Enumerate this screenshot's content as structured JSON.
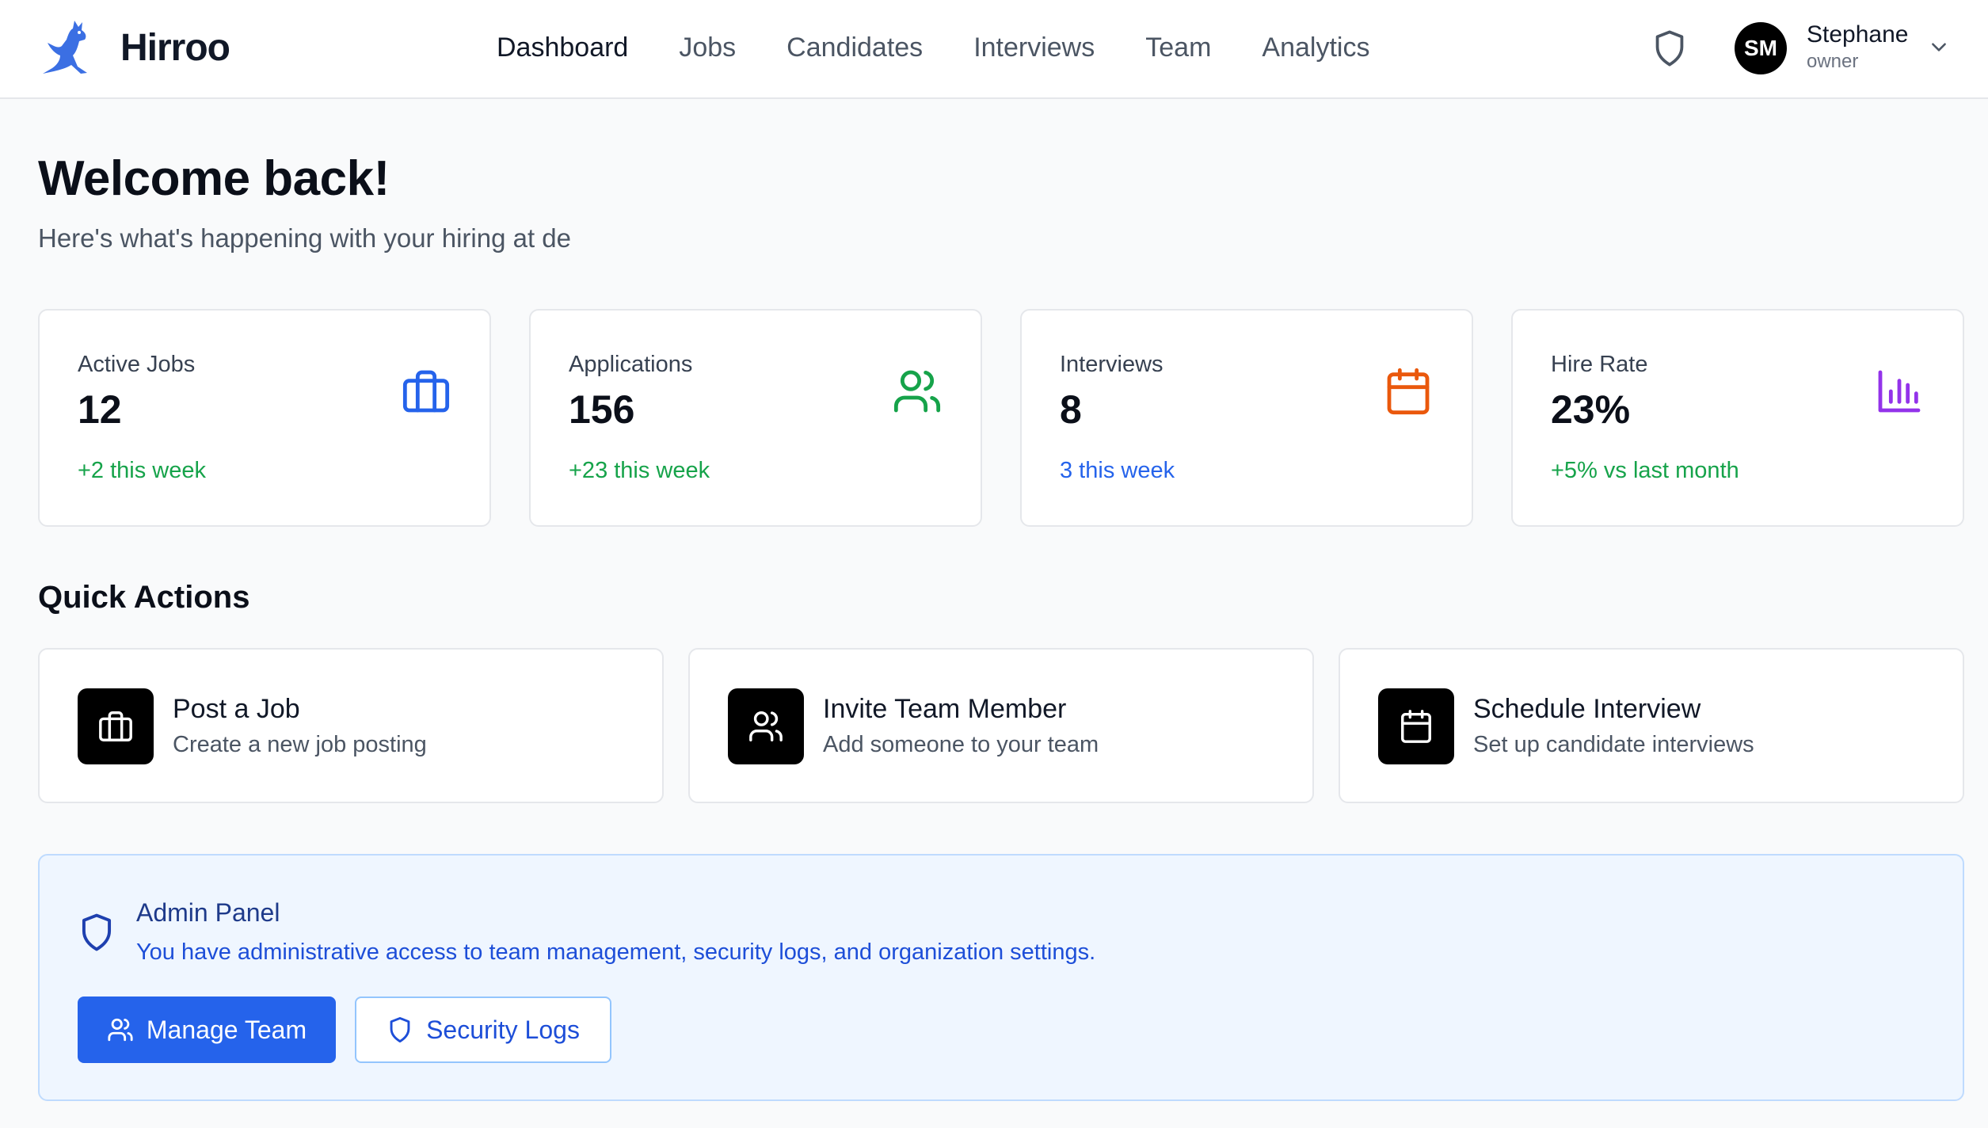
{
  "app": {
    "name": "Hirroo",
    "logo_icon": "kangaroo-logo-icon"
  },
  "nav": {
    "items": [
      {
        "label": "Dashboard",
        "active": true
      },
      {
        "label": "Jobs"
      },
      {
        "label": "Candidates"
      },
      {
        "label": "Interviews"
      },
      {
        "label": "Team"
      },
      {
        "label": "Analytics"
      }
    ]
  },
  "user": {
    "initials": "SM",
    "name": "Stephane",
    "role": "owner"
  },
  "welcome": {
    "title": "Welcome back!",
    "subtitle": "Here's what's happening with your hiring at de"
  },
  "stats": [
    {
      "label": "Active Jobs",
      "value": "12",
      "delta": "+2 this week",
      "icon": "briefcase-icon",
      "icon_color": "#2563eb",
      "delta_color": "#16a34a"
    },
    {
      "label": "Applications",
      "value": "156",
      "delta": "+23 this week",
      "icon": "users-icon",
      "icon_color": "#16a34a",
      "delta_color": "#16a34a"
    },
    {
      "label": "Interviews",
      "value": "8",
      "delta": "3 this week",
      "icon": "calendar-icon",
      "icon_color": "#ea580c",
      "delta_color": "#2563eb"
    },
    {
      "label": "Hire Rate",
      "value": "23%",
      "delta": "+5% vs last month",
      "icon": "bar-chart-icon",
      "icon_color": "#9333ea",
      "delta_color": "#16a34a"
    }
  ],
  "quick_actions": {
    "title": "Quick Actions",
    "items": [
      {
        "title": "Post a Job",
        "subtitle": "Create a new job posting",
        "icon": "briefcase-icon"
      },
      {
        "title": "Invite Team Member",
        "subtitle": "Add someone to your team",
        "icon": "users-icon"
      },
      {
        "title": "Schedule Interview",
        "subtitle": "Set up candidate interviews",
        "icon": "calendar-icon"
      }
    ]
  },
  "admin": {
    "title": "Admin Panel",
    "text": "You have administrative access to team management, security logs, and organization settings.",
    "manage_team_label": "Manage Team",
    "security_logs_label": "Security Logs"
  },
  "colors": {
    "accent": "#2563eb",
    "admin_bg": "#eff6ff",
    "admin_border": "#bfdbfe"
  }
}
